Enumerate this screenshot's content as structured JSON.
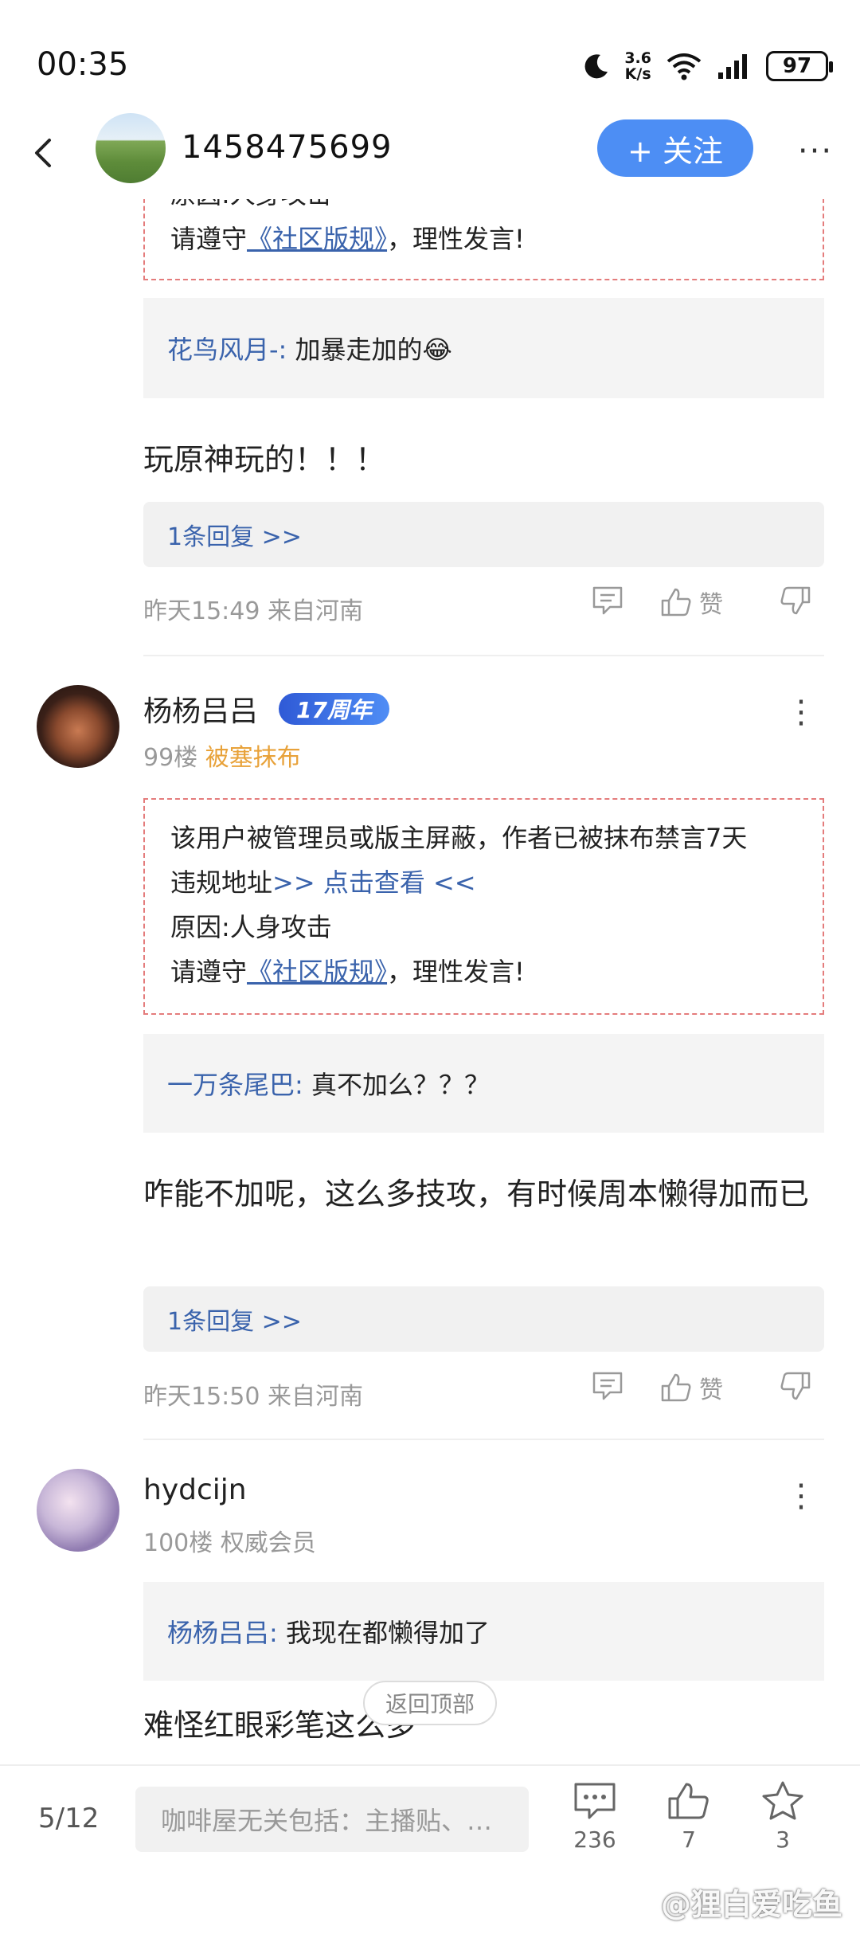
{
  "status_bar": {
    "time": "00:35",
    "netspeed_value": "3.6",
    "netspeed_unit": "K/s",
    "battery": "97"
  },
  "header": {
    "name": "1458475699",
    "follow_label": "+ 关注",
    "more_label": "···"
  },
  "top_notice": {
    "reason": "原因:人身攻击",
    "rule_prefix": "请遵守",
    "rule_link": "《社区版规》",
    "rule_suffix": "，理性发言!"
  },
  "top_reply": {
    "name": "花鸟风月-:",
    "text": "加暴走加的😂"
  },
  "post_98": {
    "text": "玩原神玩的！！！",
    "more_reply": "1条回复 >>",
    "meta": "昨天15:49 来自河南",
    "like_label": "赞"
  },
  "post_99": {
    "username": "杨杨吕吕",
    "badge": "17周年",
    "floor": "99楼",
    "tag": "被塞抹布",
    "notice_line1": "该用户被管理员或版主屏蔽，作者已被抹布禁言7天",
    "notice_line2_prefix": "违规地址",
    "notice_line2_link": ">> 点击查看 <<",
    "notice_reason": "原因:人身攻击",
    "rule_prefix": "请遵守",
    "rule_link": "《社区版规》",
    "rule_suffix": "，理性发言!",
    "reply_name": "一万条尾巴:",
    "reply_text": "真不加么？？？",
    "text": "咋能不加呢，这么多技攻，有时候周本懒得加而已",
    "more_reply": "1条回复 >>",
    "meta": "昨天15:50 来自河南",
    "like_label": "赞"
  },
  "post_100": {
    "username": "hydcijn",
    "floor": "100楼",
    "tag": "权威会员",
    "reply_name": "杨杨吕吕:",
    "reply_text": "我现在都懒得加了",
    "text": "难怪红眼彩笔这么多"
  },
  "back_to_top": "返回顶部",
  "bottom_bar": {
    "page": "5/12",
    "input_placeholder": "咖啡屋无关包括：主播贴、…",
    "comments_count": "236",
    "likes_count": "7",
    "favorites_count": "3"
  },
  "watermark": "@狸白爱吃鱼",
  "colors": {
    "accent": "#4d8ef4",
    "link": "#3a63ac",
    "notice_border": "#e47c7c",
    "tag_orange": "#e8a23a"
  }
}
